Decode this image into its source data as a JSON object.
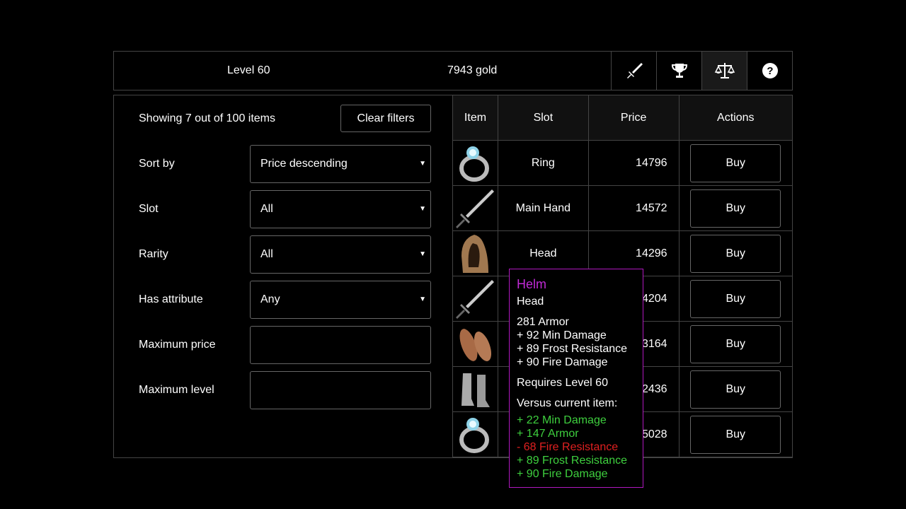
{
  "header": {
    "level": "Level 60",
    "gold": "7943 gold",
    "icons": [
      "sword-icon",
      "trophy-icon",
      "scales-icon",
      "help-icon"
    ]
  },
  "filters": {
    "showing": "Showing 7 out of 100 items",
    "clear_label": "Clear filters",
    "sort_label": "Sort by",
    "sort_value": "Price descending",
    "slot_label": "Slot",
    "slot_value": "All",
    "rarity_label": "Rarity",
    "rarity_value": "All",
    "attr_label": "Has attribute",
    "attr_value": "Any",
    "maxprice_label": "Maximum price",
    "maxlevel_label": "Maximum level"
  },
  "table": {
    "headers": [
      "Item",
      "Slot",
      "Price",
      "Actions"
    ],
    "rows": [
      {
        "icon": "ring-icon",
        "slot": "Ring",
        "price": "14796",
        "action": "Buy"
      },
      {
        "icon": "sword-item-icon",
        "slot": "Main Hand",
        "price": "14572",
        "action": "Buy"
      },
      {
        "icon": "hood-icon",
        "slot": "Head",
        "price": "14296",
        "action": "Buy"
      },
      {
        "icon": "sword-item-icon",
        "slot": "",
        "price": "14204",
        "action": "Buy"
      },
      {
        "icon": "sandals-icon",
        "slot": "",
        "price": "13164",
        "action": "Buy"
      },
      {
        "icon": "greaves-icon",
        "slot": "",
        "price": "12436",
        "action": "Buy"
      },
      {
        "icon": "ring-icon",
        "slot": "",
        "price": "15028",
        "action": "Buy"
      }
    ]
  },
  "tooltip": {
    "name": "Helm",
    "slot": "Head",
    "stats": [
      "281  Armor",
      "+ 92  Min Damage",
      "+ 89  Frost Resistance",
      "+ 90  Fire Damage"
    ],
    "requires": "Requires Level 60",
    "versus": "Versus current item:",
    "diffs": [
      {
        "text": "+  22 Min Damage",
        "kind": "plus"
      },
      {
        "text": "+  147 Armor",
        "kind": "plus"
      },
      {
        "text": "-  68 Fire Resistance",
        "kind": "minus"
      },
      {
        "text": "+  89 Frost Resistance",
        "kind": "plus"
      },
      {
        "text": "+  90 Fire Damage",
        "kind": "plus"
      }
    ],
    "colors": {
      "name": "#c02ad6",
      "border": "#b018c0",
      "plus": "#3ecf3e",
      "minus": "#e02020"
    }
  }
}
